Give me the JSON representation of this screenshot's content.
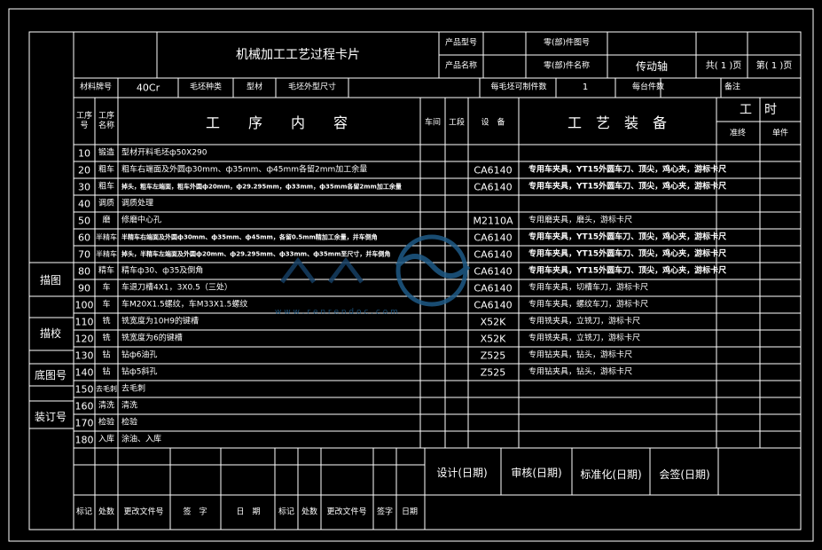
{
  "title": "机械加工工艺过程卡片",
  "header": {
    "product_model_label": "产品型号",
    "product_name_label": "产品名称",
    "part_drawing_label": "零(部)件图号",
    "part_name_label": "零(部)件名称",
    "part_name_value": "传动轴",
    "total_pages": "共( 1 )页",
    "page_no": "第( 1 )页"
  },
  "material": {
    "grade_label": "材料牌号",
    "grade_value": "40Cr",
    "blank_type_label": "毛坯种类",
    "blank_type_value": "型材",
    "blank_size_label": "毛坯外型尺寸",
    "per_blank_label": "每毛坯可制件数",
    "per_blank_value": "1",
    "per_unit_label": "每台件数",
    "remark_label": "备注"
  },
  "columns": {
    "op_no": "工序号",
    "op_name": "工序名称",
    "op_content": "工　　序　　内　　容",
    "workshop": "车间",
    "section": "工段",
    "equipment": "设　备",
    "tooling": "工　艺　装　备",
    "time": "工　时",
    "prep_time": "准终",
    "unit_time": "单件"
  },
  "operations": [
    {
      "no": "10",
      "name": "锻造",
      "content": "型材开料毛坯ф50X290",
      "equip": "",
      "tool": ""
    },
    {
      "no": "20",
      "name": "粗车",
      "content": "粗车右端面及外圆ф30mm、ф35mm、ф45mm各留2mm加工余量",
      "equip": "CA6140",
      "tool": "专用车夹具，YT15外圆车刀、顶尖，鸡心夹，游标卡尺"
    },
    {
      "no": "30",
      "name": "粗车",
      "content": "掉头，粗车左端面，粗车外圆ф20mm，ф29.295mm，ф33mm，ф35mm各留2mm加工余量",
      "equip": "CA6140",
      "tool": "专用车夹具，YT15外圆车刀、顶尖，鸡心夹，游标卡尺"
    },
    {
      "no": "40",
      "name": "调质",
      "content": "调质处理",
      "equip": "",
      "tool": ""
    },
    {
      "no": "50",
      "name": "磨",
      "content": "修磨中心孔",
      "equip": "M2110A",
      "tool": "专用磨夹具，磨头，游标卡尺"
    },
    {
      "no": "60",
      "name": "半精车",
      "content": "半精车右端面及外圆ф30mm、ф35mm、ф45mm，各留0.5mm精加工余量，并车倒角",
      "equip": "CA6140",
      "tool": "专用车夹具，YT15外圆车刀、顶尖，鸡心夹，游标卡尺"
    },
    {
      "no": "70",
      "name": "半精车",
      "content": "掉头，半精车左端面及外圆ф20mm、ф29.295mm、ф33mm、ф35mm至尺寸，并车倒角",
      "equip": "CA6140",
      "tool": "专用车夹具，YT15外圆车刀、顶尖，鸡心夹，游标卡尺"
    },
    {
      "no": "80",
      "name": "精车",
      "content": "精车ф30、ф35及倒角",
      "equip": "CA6140",
      "tool": "专用车夹具，YT15外圆车刀、顶尖，鸡心夹，游标卡尺"
    },
    {
      "no": "90",
      "name": "车",
      "content": "车退刀槽4X1，3X0.5（三处）",
      "equip": "CA6140",
      "tool": "专用车夹具，切槽车刀，游标卡尺"
    },
    {
      "no": "100",
      "name": "车",
      "content": "车M20X1.5螺纹，车M33X1.5螺纹",
      "equip": "CA6140",
      "tool": "专用车夹具，螺纹车刀，游标卡尺"
    },
    {
      "no": "110",
      "name": "铣",
      "content": "铣宽度为10H9的键槽",
      "equip": "X52K",
      "tool": "专用铣夹具，立铣刀，游标卡尺"
    },
    {
      "no": "120",
      "name": "铣",
      "content": "铣宽度为6的键槽",
      "equip": "X52K",
      "tool": "专用铣夹具，立铣刀，游标卡尺"
    },
    {
      "no": "130",
      "name": "钻",
      "content": "钻ф6油孔",
      "equip": "Z525",
      "tool": "专用钻夹具，钻头，游标卡尺"
    },
    {
      "no": "140",
      "name": "钻",
      "content": "钻ф5斜孔",
      "equip": "Z525",
      "tool": "专用钻夹具，钻头，游标卡尺"
    },
    {
      "no": "150",
      "name": "去毛刺",
      "content": "去毛刺",
      "equip": "",
      "tool": ""
    },
    {
      "no": "160",
      "name": "清洗",
      "content": "清洗",
      "equip": "",
      "tool": ""
    },
    {
      "no": "170",
      "name": "检验",
      "content": "检验",
      "equip": "",
      "tool": ""
    },
    {
      "no": "180",
      "name": "入库",
      "content": "涂油、入库",
      "equip": "",
      "tool": ""
    }
  ],
  "side_labels": {
    "trace": "描图",
    "trace_check": "描校",
    "base_drawing_no": "底图号",
    "binding_no": "装订号"
  },
  "sign": {
    "design": "设计(日期)",
    "review": "审核(日期)",
    "standard": "标准化(日期)",
    "countersign": "会签(日期)"
  },
  "footer": {
    "mark": "标记",
    "count": "处数",
    "change_doc": "更改文件号",
    "signature": "签　字",
    "date": "日　期",
    "mark2": "标记",
    "count2": "处数",
    "change_doc2": "更改文件号",
    "signature2": "签字",
    "date2": "日期"
  },
  "watermark": {
    "url": "w w w . r e n r e n d o c . c o m"
  }
}
